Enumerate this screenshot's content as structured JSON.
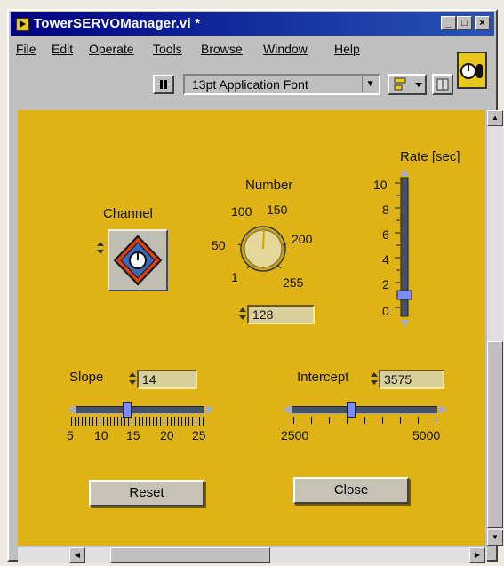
{
  "window": {
    "title": "TowerSERVOManager.vi *",
    "controls": [
      "_",
      "□",
      "×"
    ]
  },
  "menu": [
    "File",
    "Edit",
    "Operate",
    "Tools",
    "Browse",
    "Window",
    "Help"
  ],
  "toolbar": {
    "font": "13pt Application Font"
  },
  "panel": {
    "background": "#dfb315",
    "channel": {
      "label": "Channel"
    },
    "number": {
      "label": "Number",
      "ticks": [
        "1",
        "50",
        "100",
        "150",
        "200",
        "255"
      ],
      "value": "128"
    },
    "rate": {
      "label": "Rate [sec]",
      "ticks": [
        "10",
        "8",
        "6",
        "4",
        "2",
        "0"
      ],
      "value_fraction": 0.1
    },
    "slope": {
      "label": "Slope",
      "value": "14",
      "ticks": [
        "5",
        "10",
        "15",
        "20",
        "25"
      ]
    },
    "intercept": {
      "label": "Intercept",
      "value": "3575",
      "ticks": [
        "2500",
        "5000"
      ]
    },
    "reset_label": "Reset",
    "close_label": "Close"
  }
}
